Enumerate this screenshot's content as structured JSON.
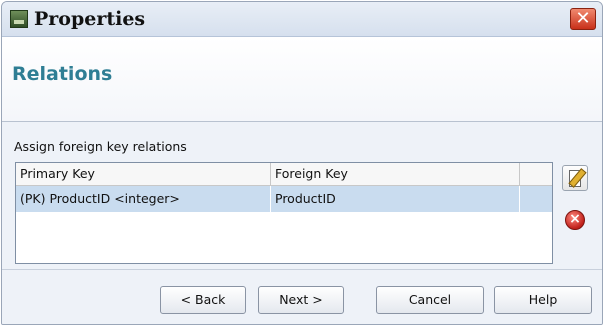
{
  "window": {
    "title": "Properties",
    "close_glyph": "✕"
  },
  "icons": {
    "app": "database-app-icon",
    "edit": "edit-relation-icon",
    "delete": "delete-relation-icon"
  },
  "header": {
    "title": "Relations"
  },
  "content": {
    "instruction": "Assign foreign key relations"
  },
  "grid": {
    "columns": [
      "Primary Key",
      "Foreign Key",
      ""
    ],
    "rows": [
      {
        "primary_key": "(PK) ProductID <integer>",
        "foreign_key": "ProductID"
      }
    ]
  },
  "buttons": {
    "back": "< Back",
    "next": "Next >",
    "cancel": "Cancel",
    "help": "Help"
  },
  "colors": {
    "section_title": "#2f7e94",
    "selected_row": "#c9dcef",
    "close_button": "#d8452a"
  }
}
